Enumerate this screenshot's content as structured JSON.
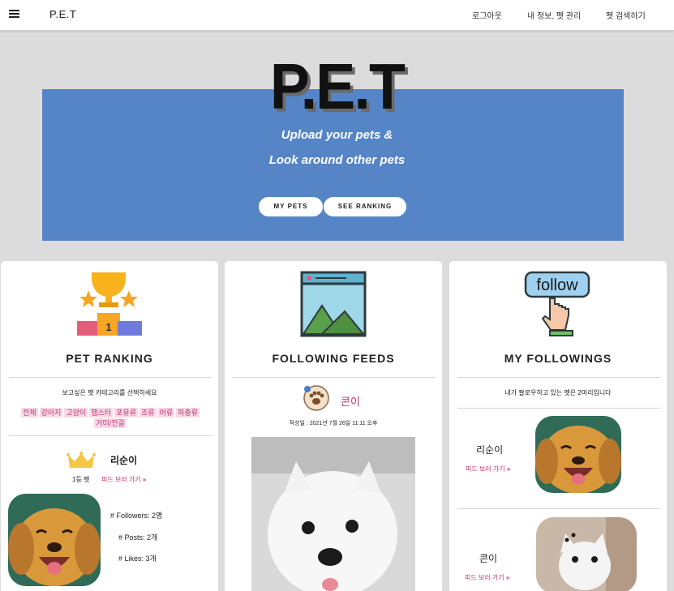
{
  "nav": {
    "brand": "P.E.T",
    "logout": "로그아웃",
    "my_info": "내 정보, 펫 관리",
    "pet_search": "펫 검색하기"
  },
  "hero": {
    "title": "P.E.T",
    "subtitle_line1": "Upload your pets &",
    "subtitle_line2": "Look around other pets",
    "btn_my_pets": "MY PETS",
    "btn_see_ranking": "SEE RANKING"
  },
  "ranking": {
    "title": "PET RANKING",
    "instruction": "보고싶은 펫 카테고리를 선택하세요",
    "categories": [
      "전체",
      "강아지",
      "고양이",
      "햄스터",
      "포유류",
      "조류",
      "어류",
      "파충류",
      "거미/전갈"
    ],
    "top_pet_name": "리순이",
    "rank_label": "1등 펫",
    "feed_link": "피드 보러 가기",
    "followers": "# Followers: 2명",
    "posts": "# Posts: 2개",
    "likes": "# Likes: 3개"
  },
  "feeds": {
    "title": "FOLLOWING FEEDS",
    "author": "콘이",
    "date": "작성일 : 2021년 7월 26일 11:11 오후"
  },
  "followings": {
    "title": "MY FOLLOWINGS",
    "info": "내가 팔로우하고 있는 펫은 2마리입니다",
    "items": [
      {
        "name": "리순이",
        "link": "피드 보러 가기"
      },
      {
        "name": "콘이",
        "link": "피드 보러 가기"
      }
    ],
    "icon_text": "follow"
  },
  "colors": {
    "hero_blue": "#5585c6",
    "accent_pink": "#c2357a",
    "tag_bg": "#f7dbe6"
  }
}
